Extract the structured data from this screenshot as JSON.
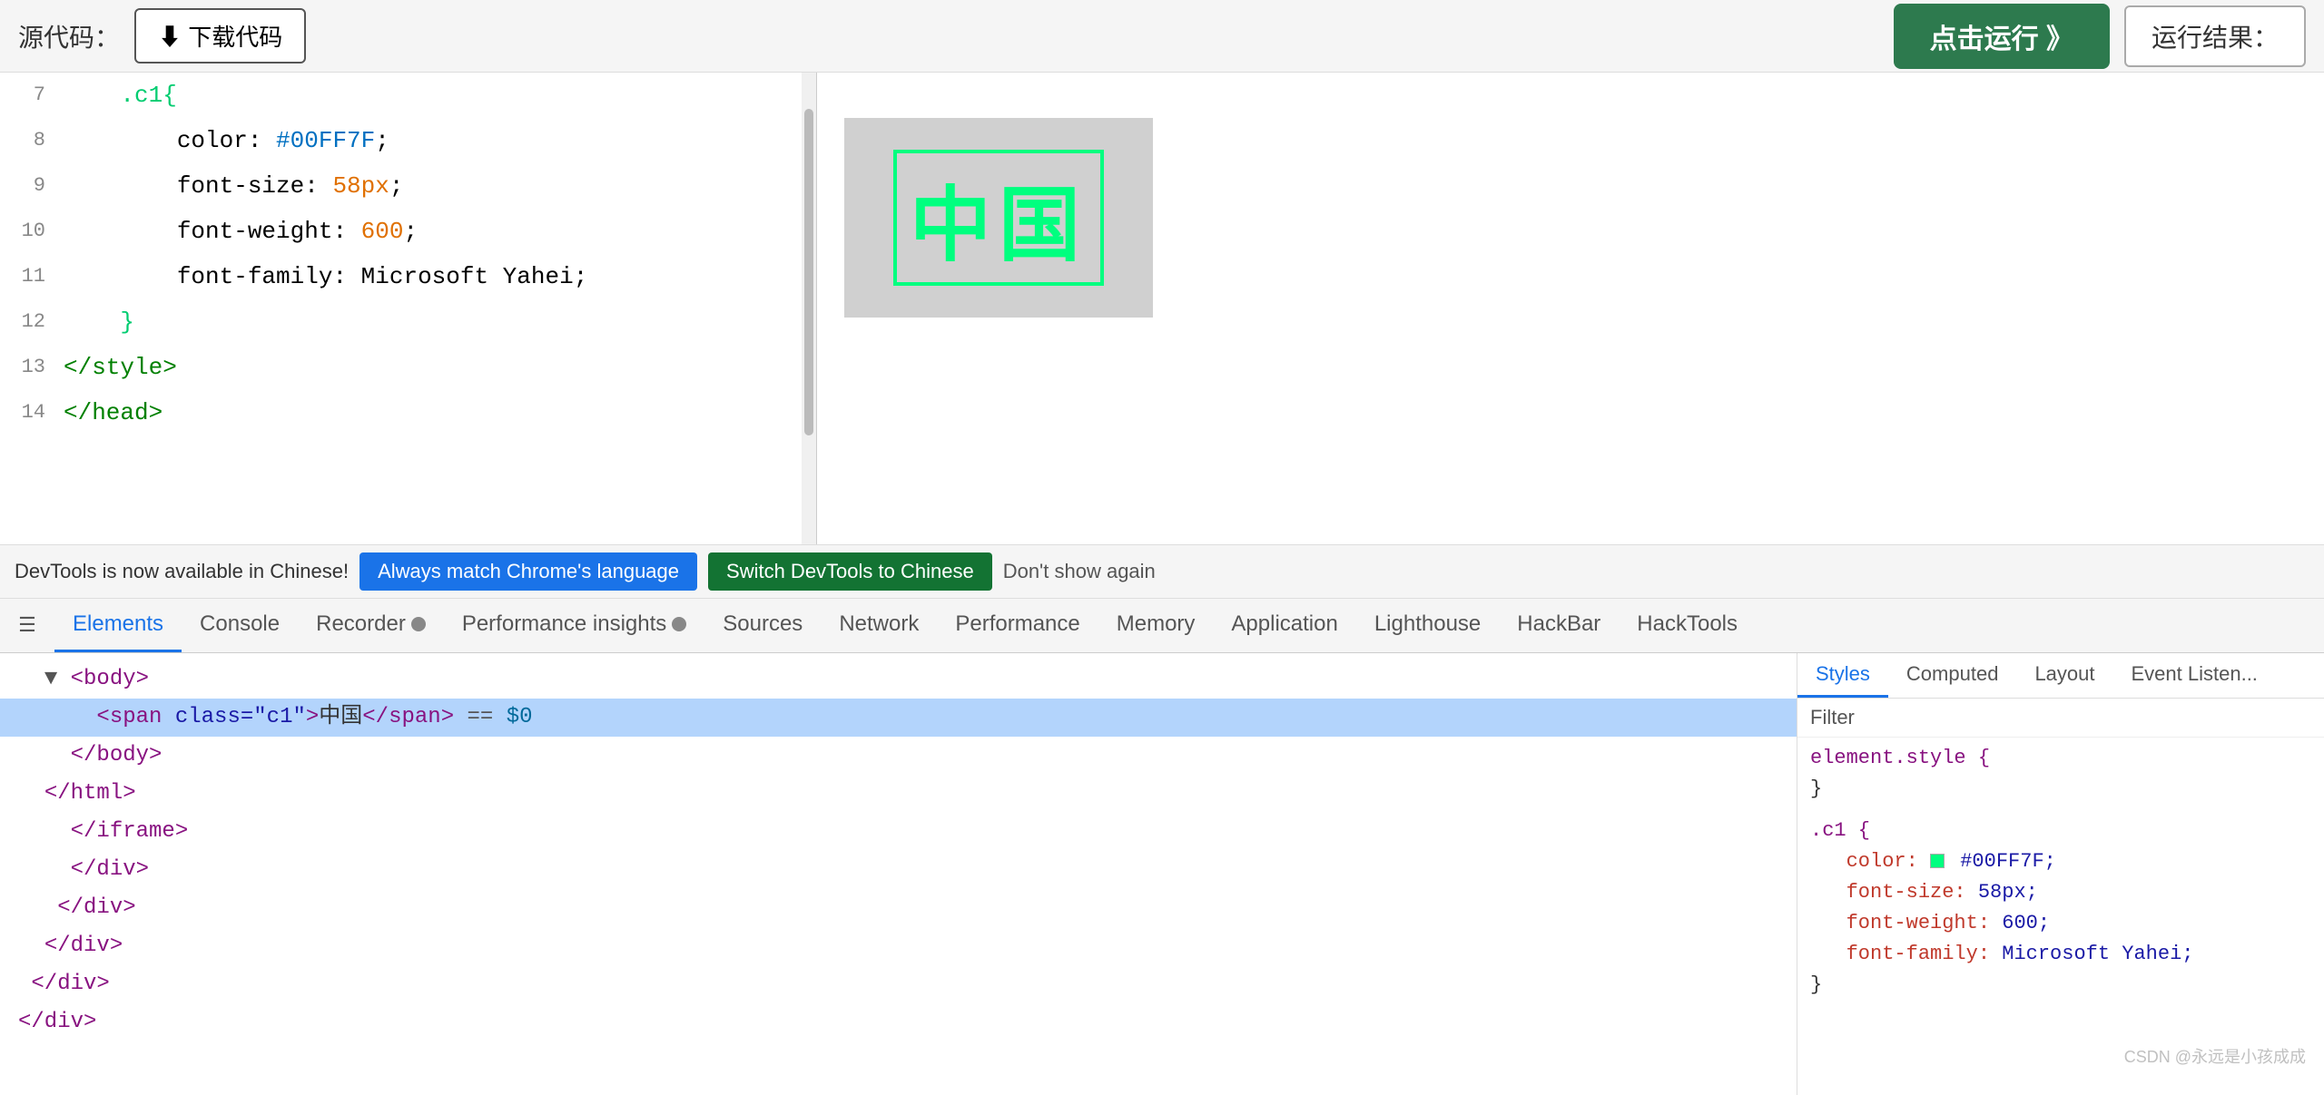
{
  "topbar": {
    "source_label": "源代码：",
    "download_label": "⬇ 下载代码",
    "run_label": "点击运行 》",
    "result_label": "运行结果："
  },
  "code_lines": [
    {
      "num": "7",
      "content": "    .c1{"
    },
    {
      "num": "8",
      "content": "        color: #00FF7F;"
    },
    {
      "num": "9",
      "content": "        font-size: 58px;"
    },
    {
      "num": "10",
      "content": "        font-weight: 600;"
    },
    {
      "num": "11",
      "content": "        font-family: Microsoft Yahei;"
    },
    {
      "num": "12",
      "content": "    }"
    },
    {
      "num": "13",
      "content": "</style>"
    },
    {
      "num": "14",
      "content": "</head>"
    }
  ],
  "result": {
    "zh_chars": "中国"
  },
  "devtools_notify": {
    "message": "DevTools is now available in Chinese!",
    "btn1_label": "Always match Chrome's language",
    "btn2_label": "Switch DevTools to Chinese",
    "btn3_label": "Don't show again"
  },
  "tabs": [
    {
      "label": "Elements",
      "active": true
    },
    {
      "label": "Console",
      "active": false
    },
    {
      "label": "Recorder 🔴",
      "active": false
    },
    {
      "label": "Performance insights 🔴",
      "active": false
    },
    {
      "label": "Sources",
      "active": false
    },
    {
      "label": "Network",
      "active": false
    },
    {
      "label": "Performance",
      "active": false
    },
    {
      "label": "Memory",
      "active": false
    },
    {
      "label": "Application",
      "active": false
    },
    {
      "label": "Lighthouse",
      "active": false
    },
    {
      "label": "HackBar",
      "active": false
    },
    {
      "label": "HackTools",
      "active": false
    }
  ],
  "dom_lines": [
    {
      "indent": "  ",
      "content": "▼ <body>",
      "selected": false
    },
    {
      "indent": "      ",
      "content": "<span class=\"c1\">中国</span> == $0",
      "selected": true
    },
    {
      "indent": "    ",
      "content": "</body>",
      "selected": false
    },
    {
      "indent": "  ",
      "content": "</html>",
      "selected": false
    },
    {
      "indent": "",
      "content": "  </iframe>",
      "selected": false
    },
    {
      "indent": "",
      "content": "</div>",
      "selected": false
    },
    {
      "indent": "",
      "content": "  </div>",
      "selected": false
    },
    {
      "indent": "",
      "content": "    </div>",
      "selected": false
    },
    {
      "indent": "",
      "content": "  </div>",
      "selected": false
    },
    {
      "indent": "",
      "content": "</div>",
      "selected": false
    }
  ],
  "styles_subtabs": [
    "Styles",
    "Computed",
    "Layout",
    "Event Listeners"
  ],
  "styles_filter": "Filter",
  "styles_rules": [
    {
      "selector": "element.style {",
      "props": [],
      "closing": "}"
    },
    {
      "selector": ".c1 {",
      "props": [
        {
          "name": "color:",
          "value": "#00FF7F;",
          "color_swatch": true
        },
        {
          "name": "font-size:",
          "value": "58px;"
        },
        {
          "name": "font-weight:",
          "value": "600;"
        },
        {
          "name": "font-family:",
          "value": "Microsoft Yahei;"
        }
      ],
      "closing": "}"
    }
  ],
  "watermark": "CSDN @永远是小孩成成"
}
